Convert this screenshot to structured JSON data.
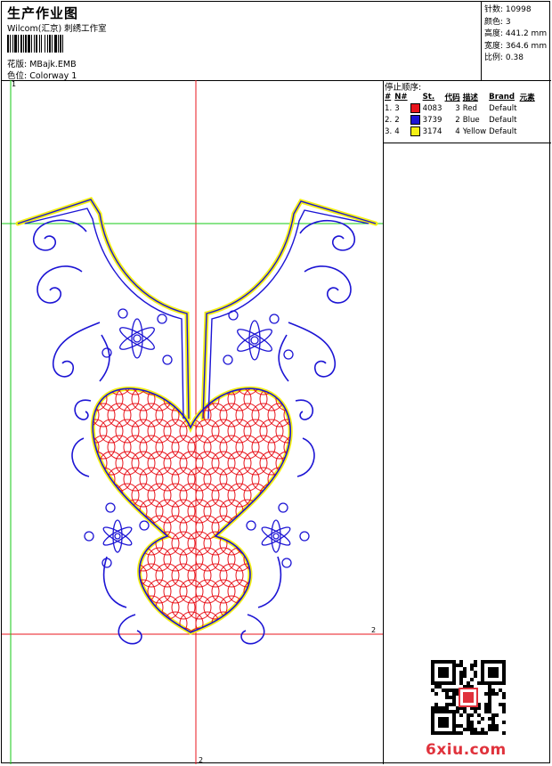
{
  "header": {
    "title": "生产作业图",
    "company": "Wilcom(汇京) 刺绣工作室",
    "design_label": "花版:",
    "design_file": "MBajk.EMB",
    "colorway_label": "色位:",
    "colorway": "Colorway 1"
  },
  "stats": [
    {
      "label": "针数:",
      "value": "10998"
    },
    {
      "label": "颜色:",
      "value": "3"
    },
    {
      "label": "高度:",
      "value": "441.2 mm"
    },
    {
      "label": "宽度:",
      "value": "364.6 mm"
    },
    {
      "label": "比例:",
      "value": "0.38"
    }
  ],
  "stop_sequence": {
    "title": "停止顺序:",
    "columns": [
      "#",
      "N#",
      "",
      "St.",
      "代码",
      "描述",
      "Brand",
      "元素"
    ],
    "rows": [
      {
        "index": "1.",
        "n": "3",
        "color": "#e8141c",
        "stitches": "4083",
        "code": "3",
        "desc": "Red",
        "brand": "Default"
      },
      {
        "index": "2.",
        "n": "2",
        "color": "#1c14d4",
        "stitches": "3739",
        "code": "2",
        "desc": "Blue",
        "brand": "Default"
      },
      {
        "index": "3.",
        "n": "4",
        "color": "#f4f014",
        "stitches": "3174",
        "code": "4",
        "desc": "Yellow",
        "brand": "Default"
      }
    ]
  },
  "guides": {
    "label_top": "1",
    "label_right": "2",
    "label_bottom": "2"
  },
  "design_colors": {
    "outline": "#1c14d4",
    "fill": "#e8141c",
    "underlay": "#f4f014",
    "guide_red": "#e8141c",
    "guide_green": "#16c816"
  },
  "watermark": "6xiu.com"
}
